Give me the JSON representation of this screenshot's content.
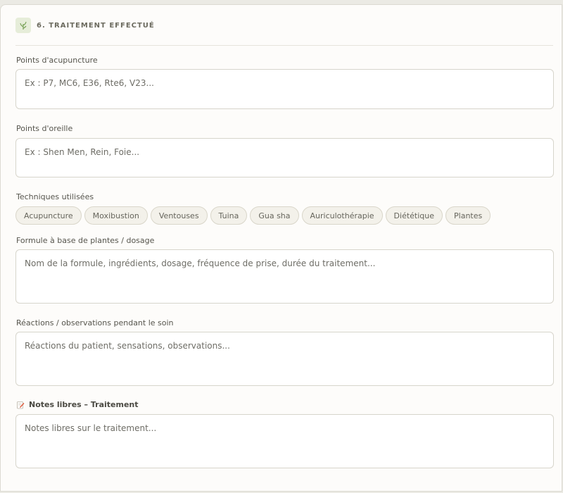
{
  "section": {
    "title": "6. TRAITEMENT EFFECTUÉ",
    "icon": "herb-icon",
    "accent": "#7aa35a"
  },
  "fields": {
    "acupuncture_points": {
      "label": "Points d'acupuncture",
      "placeholder": "Ex : P7, MC6, E36, Rte6, V23..."
    },
    "ear_points": {
      "label": "Points d'oreille",
      "placeholder": "Ex : Shen Men, Rein, Foie..."
    },
    "techniques": {
      "label": "Techniques utilisées",
      "options": [
        "Acupuncture",
        "Moxibustion",
        "Ventouses",
        "Tuina",
        "Gua sha",
        "Auriculothérapie",
        "Diététique",
        "Plantes"
      ]
    },
    "herbal_formula": {
      "label": "Formule à base de plantes / dosage",
      "placeholder": "Nom de la formule, ingrédients, dosage, fréquence de prise, durée du traitement..."
    },
    "reactions": {
      "label": "Réactions / observations pendant le soin",
      "placeholder": "Réactions du patient, sensations, observations..."
    },
    "notes": {
      "label": "Notes libres – Traitement",
      "icon": "memo-icon",
      "placeholder": "Notes libres sur le traitement..."
    }
  }
}
